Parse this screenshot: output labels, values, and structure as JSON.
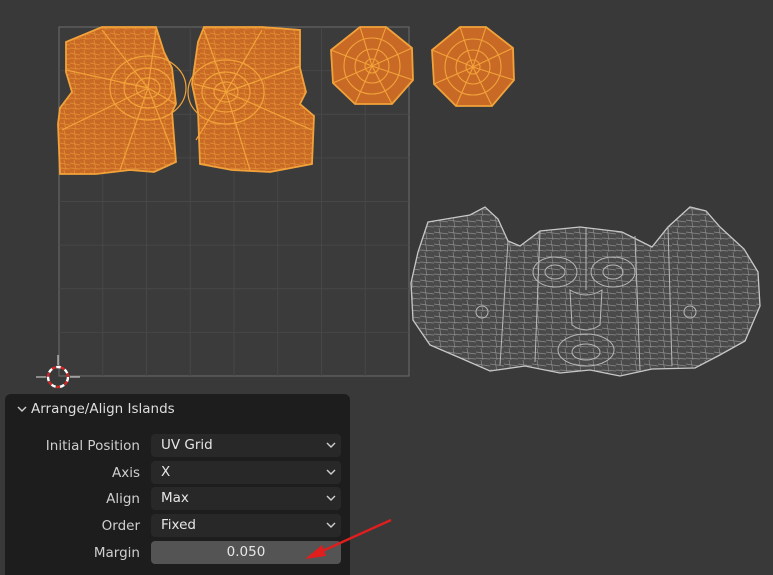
{
  "operator_panel": {
    "title": "Arrange/Align Islands",
    "properties": [
      {
        "label": "Initial Position",
        "value": "UV Grid",
        "type": "dropdown"
      },
      {
        "label": "Axis",
        "value": "X",
        "type": "dropdown"
      },
      {
        "label": "Align",
        "value": "Max",
        "type": "dropdown"
      },
      {
        "label": "Order",
        "value": "Fixed",
        "type": "dropdown"
      },
      {
        "label": "Margin",
        "value": "0.050",
        "type": "number"
      }
    ]
  },
  "colors": {
    "editor_background": "#393939",
    "uv_bounds_fill": "#3b3b3b",
    "uv_grid_line": "#474747",
    "uv_bounds_border": "#656565",
    "selected_island_fill": "#c86a25",
    "selected_island_edge": "#f2a23a",
    "unselected_island_fill": "#4a4a4a",
    "unselected_island_edge": "#b8b8b8",
    "panel_background": "#1d1d1d",
    "dropdown_background": "#282828",
    "number_field_background": "#545454",
    "annotation_arrow": "#e01e1e"
  },
  "icons": [
    "chevron-down-icon",
    "2d-cursor-icon",
    "annotation-arrow"
  ]
}
